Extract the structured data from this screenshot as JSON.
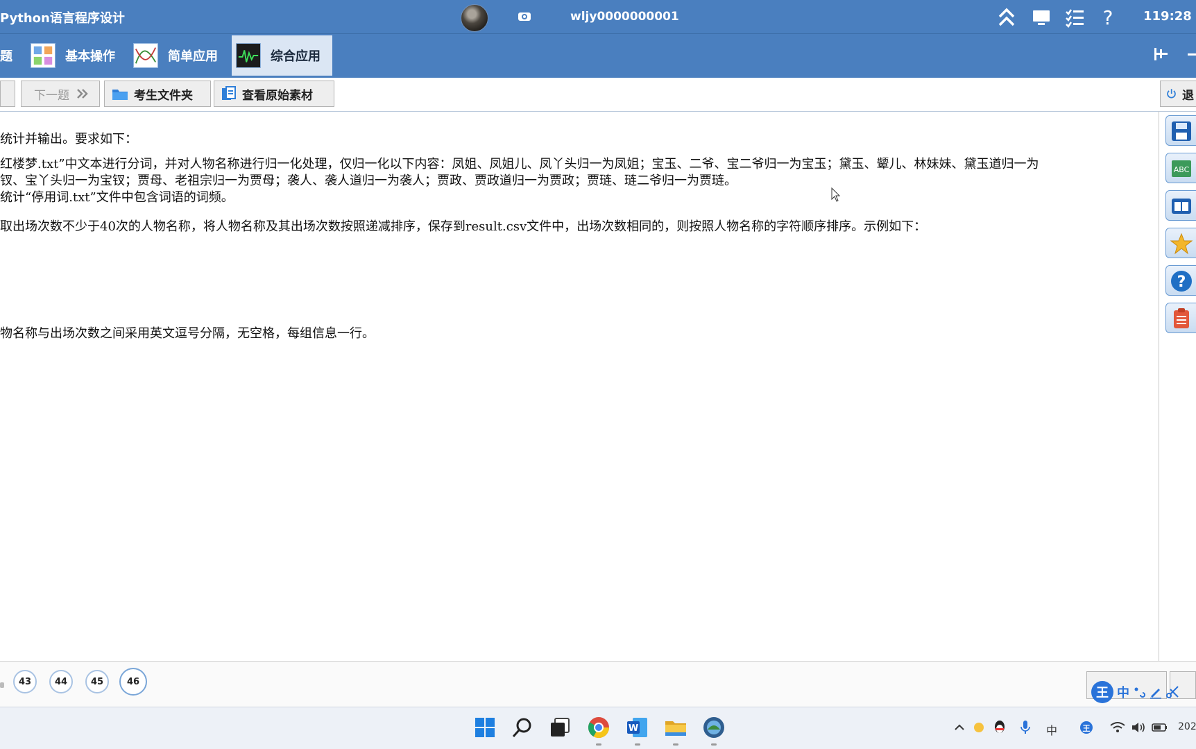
{
  "app": {
    "title": "Python语言程序设计",
    "username": "wljy0000000001",
    "clock": "119:28"
  },
  "tabs": [
    {
      "label": "题",
      "active": false
    },
    {
      "label": "基本操作",
      "active": false
    },
    {
      "label": "简单应用",
      "active": false
    },
    {
      "label": "综合应用",
      "active": true
    }
  ],
  "toolbar": {
    "prev_label": "",
    "next_label": "下一题",
    "folder_label": "考生文件夹",
    "source_label": "查看原始素材",
    "exit_label": "退"
  },
  "content": {
    "lines": [
      "统计并输出。要求如下：",
      "红楼梦.txt”中文本进行分词，并对人物名称进行归一化处理，仅归一化以下内容：凤姐、凤姐儿、凤丫头归一为凤姐；宝玉、二爷、宝二爷归一为宝玉；黛玉、颦儿、林妹妹、黛玉道归一为",
      "钗、宝丫头归一为宝钗；贾母、老祖宗归一为贾母；袭人、袭人道归一为袭人；贾政、贾政道归一为贾政；贾琏、琏二爷归一为贾琏。",
      "统计“停用词.txt”文件中包含词语的词频。",
      "取出场次数不少于40次的人物名称，将人物名称及其出场次数按照递减排序，保存到result.csv文件中，出场次数相同的，则按照人物名称的字符顺序排序。示例如下：",
      "物名称与出场次数之间采用英文逗号分隔，无空格，每组信息一行。"
    ]
  },
  "side_tools": [
    "save-icon",
    "text-editor-icon",
    "window-icon",
    "star-icon",
    "help-icon",
    "notes-icon"
  ],
  "question_numbers": [
    "43",
    "44",
    "45",
    "46"
  ],
  "current_question": "46",
  "ime": {
    "label": "中"
  },
  "taskbar": {
    "apps": [
      "start-icon",
      "search-icon",
      "task-view-icon",
      "chrome-icon",
      "word-icon",
      "file-explorer-icon",
      "exam-app-icon"
    ],
    "tray_lang": "中",
    "date_fragment": "202"
  },
  "colors": {
    "header_blue": "#4a7fbf",
    "active_tab": "#dbe6f4"
  }
}
